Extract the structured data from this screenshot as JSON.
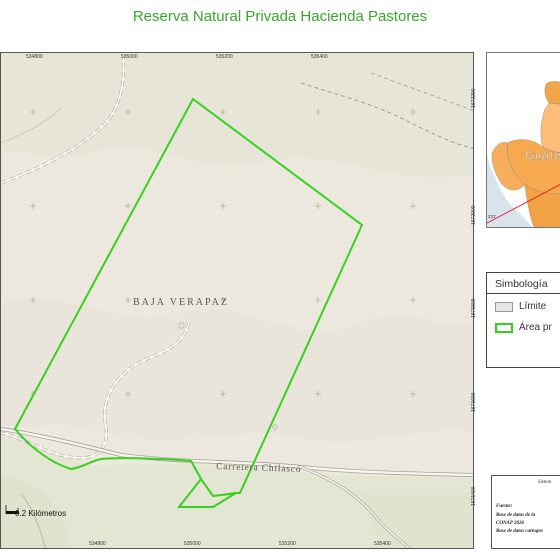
{
  "page": {
    "title": "Reserva Natural Privada Hacienda Pastores"
  },
  "map": {
    "region_label": "BAJA VERAPAZ",
    "road_label": "Carretera Chilascó",
    "x_ticks": [
      "534800",
      "535000",
      "535200",
      "535400"
    ],
    "y_ticks": [
      "1672200",
      "1672000",
      "1671800",
      "1671600",
      "1671400"
    ],
    "scale_label": "0.2 Kilómetros",
    "colors": {
      "boundary": "#39d01f",
      "base": "#ece8dd",
      "lowland": "#e4e6d4"
    }
  },
  "inset": {
    "label": "Guate",
    "grid_label": "Z37"
  },
  "legend": {
    "title": "Simbología",
    "items": [
      {
        "label": "Límite"
      },
      {
        "label": "Área pr"
      }
    ]
  },
  "info": {
    "heading": "Sistem",
    "source_label": "Fuente:",
    "line1": "Base de datos de la",
    "line2": "CONAP 2026",
    "line3": "Base de datos cartogra"
  }
}
